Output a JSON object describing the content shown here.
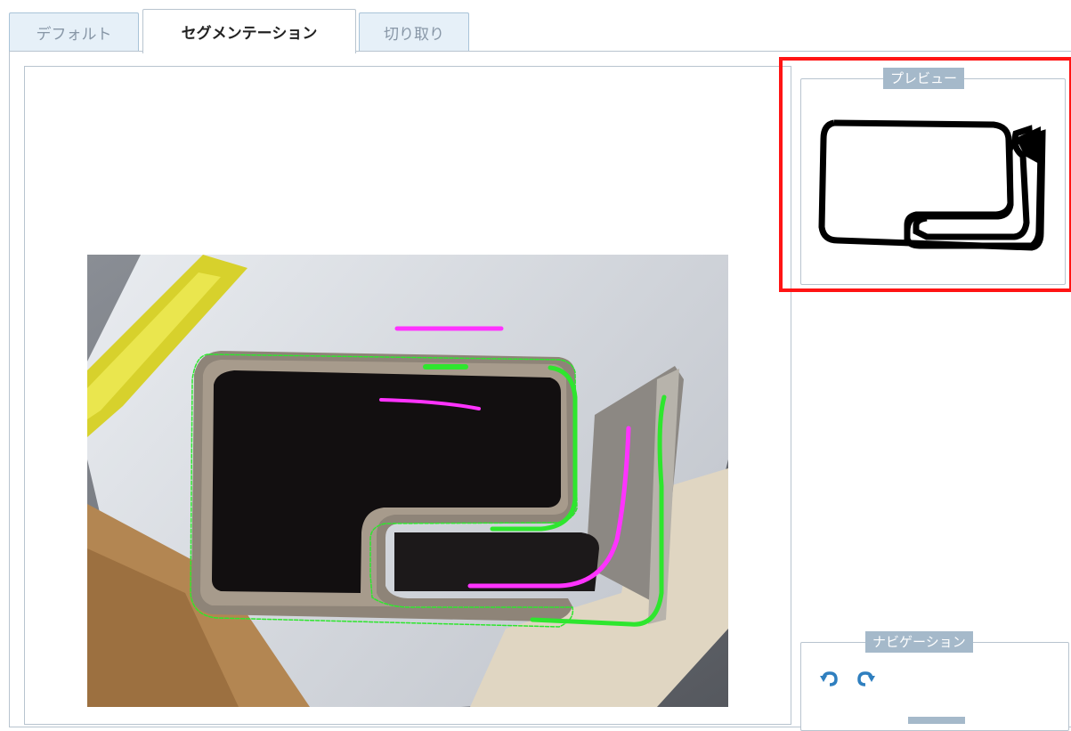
{
  "tabs": [
    {
      "label": "デフォルト",
      "active": false
    },
    {
      "label": "セグメンテーション",
      "active": true
    },
    {
      "label": "切り取り",
      "active": false
    }
  ],
  "preview": {
    "legend": "プレビュー"
  },
  "navigation": {
    "legend": "ナビゲーション",
    "buttons": [
      {
        "icon": "undo-icon"
      },
      {
        "icon": "redo-icon"
      }
    ]
  },
  "colors": {
    "foreground_stroke": "#2ee62e",
    "background_stroke": "#ff33ff",
    "highlight": "#ff1414",
    "nav_icon": "#2f7fbf"
  }
}
